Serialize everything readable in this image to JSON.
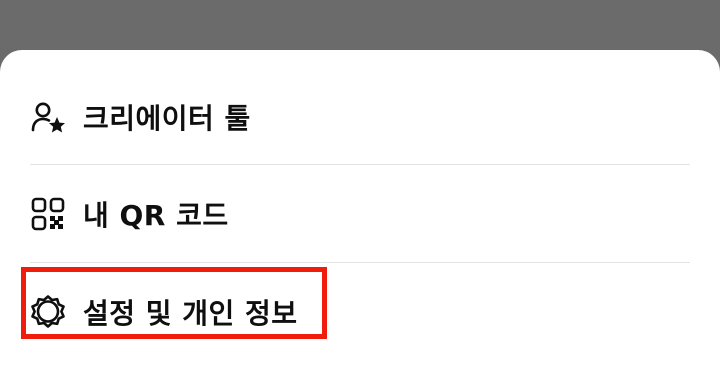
{
  "menu": {
    "items": [
      {
        "label": "크리에이터 툴",
        "icon": "creator-star-person-icon"
      },
      {
        "label": "내 QR 코드",
        "icon": "qr-code-icon"
      },
      {
        "label": "설정 및 개인 정보",
        "icon": "gear-icon"
      }
    ]
  },
  "highlight": {
    "color": "#f01c0c",
    "target": "설정 및 개인 정보"
  },
  "colors": {
    "overlay": "#6b6b6b",
    "sheet": "#ffffff",
    "text": "#0f0f0f",
    "divider": "#e3e3e3"
  }
}
